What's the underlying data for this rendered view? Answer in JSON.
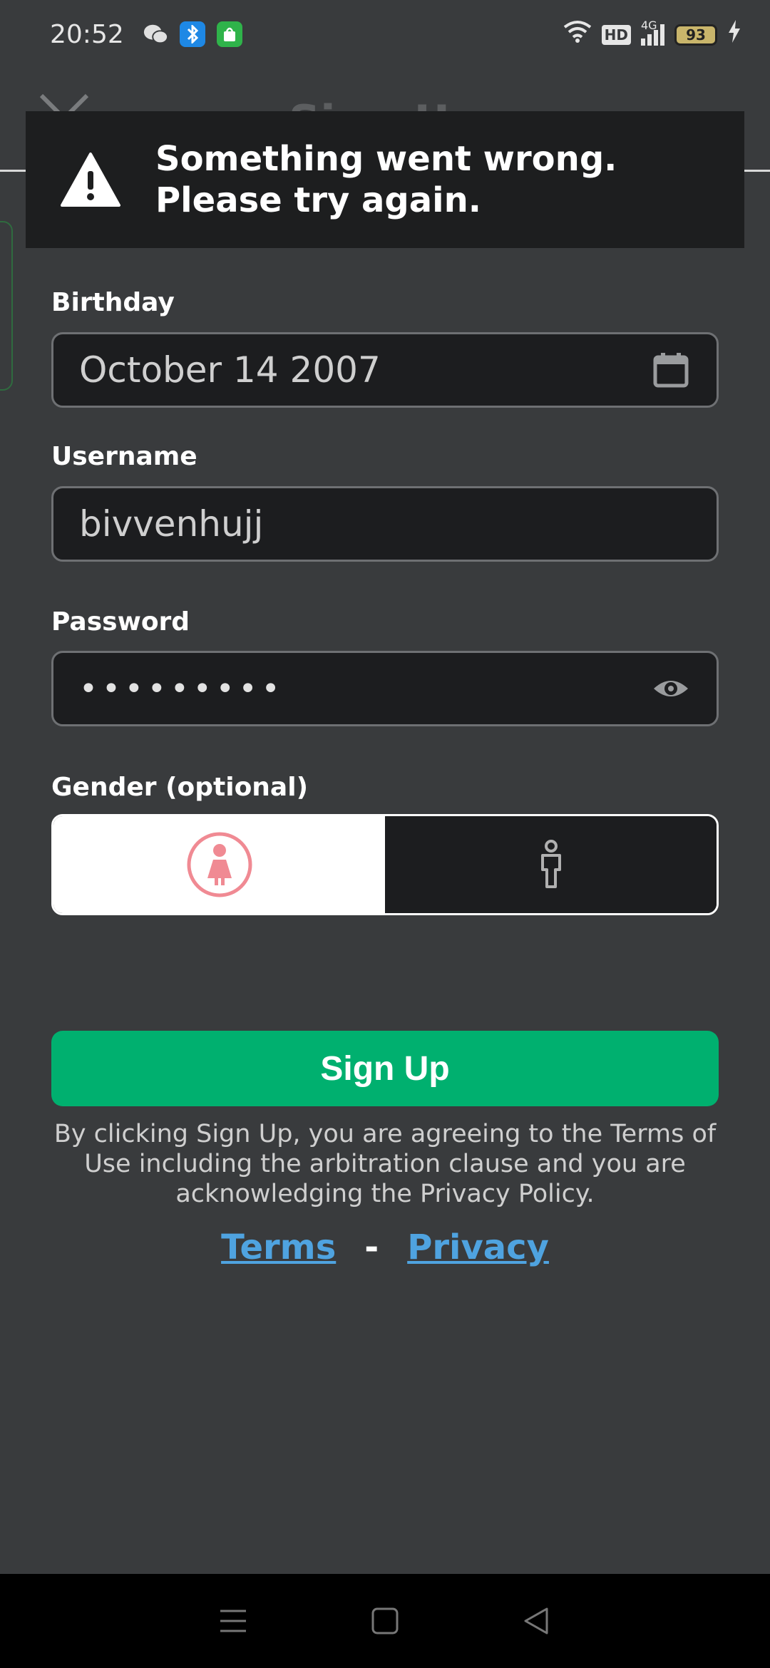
{
  "status_bar": {
    "time": "20:52",
    "battery": "93",
    "icons": [
      "wechat-icon",
      "bluetooth-app-icon",
      "store-app-icon",
      "wifi-icon",
      "hd-icon",
      "signal-4g-icon",
      "battery-icon",
      "charging-icon"
    ],
    "hd_label": "HD",
    "network_label": "4G"
  },
  "header": {
    "title": "Sign Up"
  },
  "error": {
    "message": "Something went wrong. Please try again."
  },
  "form": {
    "birthday_label": "Birthday",
    "birthday_value": "October 14 2007",
    "username_label": "Username",
    "username_value": "bivvenhujj",
    "password_label": "Password",
    "password_value": "•••••••••",
    "gender_label": "Gender (optional)"
  },
  "signup_button": "Sign Up",
  "legal": "By clicking Sign Up, you are agreeing to the Terms of Use including the arbitration clause and you are acknowledging the Privacy Policy.",
  "links": {
    "terms": "Terms",
    "separator": "-",
    "privacy": "Privacy"
  },
  "colors": {
    "background": "#393b3d",
    "accent": "#00b06f",
    "link": "#4fa3e0",
    "female_icon": "#f08a93"
  }
}
